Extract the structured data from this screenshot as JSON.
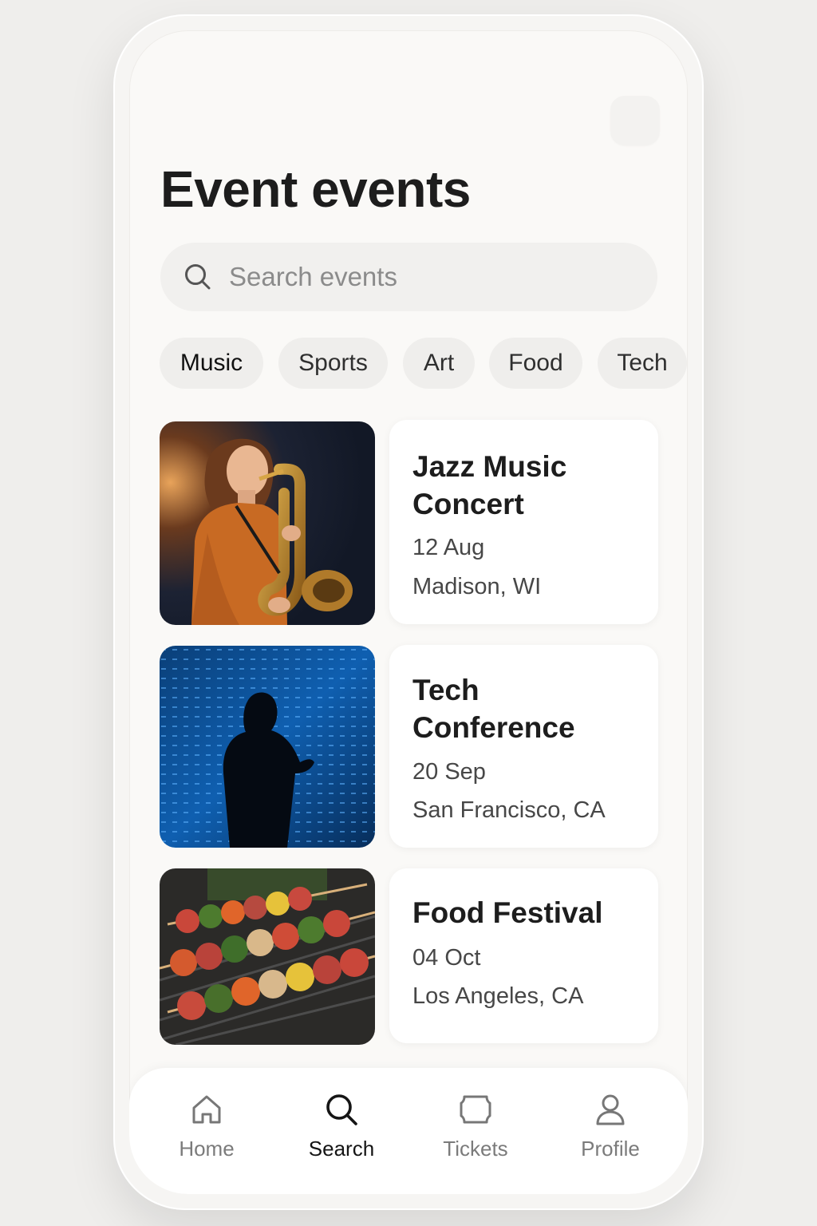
{
  "header": {
    "title": "Event events"
  },
  "search": {
    "placeholder": "Search events"
  },
  "categories": [
    {
      "label": "Music",
      "active": true
    },
    {
      "label": "Sports",
      "active": false
    },
    {
      "label": "Art",
      "active": false
    },
    {
      "label": "Food",
      "active": false
    },
    {
      "label": "Tech",
      "active": false
    }
  ],
  "events": [
    {
      "title_line1": "Jazz Music",
      "title_line2": "Concert",
      "date": "12 Aug",
      "location": "Madison, WI",
      "image": "woman-playing-saxophone-photo"
    },
    {
      "title_line1": "Tech",
      "title_line2": "Conference",
      "date": "20 Sep",
      "location": "San Francisco, CA",
      "image": "speaker-silhouette-blue-screen-photo"
    },
    {
      "title_line1": "Food Festival",
      "title_line2": "",
      "date": "04 Oct",
      "location": "Los Angeles, CA",
      "image": "grilled-kebab-skewers-photo"
    }
  ],
  "nav": {
    "items": [
      {
        "label": "Home",
        "icon": "home-icon",
        "active": false
      },
      {
        "label": "Search",
        "icon": "search-icon",
        "active": true
      },
      {
        "label": "Tickets",
        "icon": "ticket-icon",
        "active": false
      },
      {
        "label": "Profile",
        "icon": "profile-icon",
        "active": false
      }
    ]
  },
  "colors": {
    "background": "#efeeec",
    "screen": "#faf9f7",
    "card": "#ffffff",
    "chip": "#efeeec",
    "text_primary": "#1d1d1d",
    "text_secondary": "#474747",
    "nav_inactive": "#7b7b7b"
  }
}
